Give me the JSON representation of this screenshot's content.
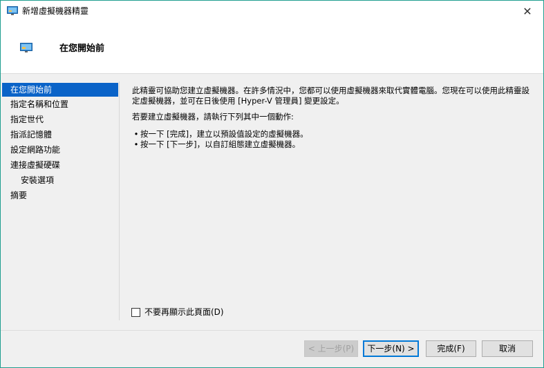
{
  "window": {
    "title": "新增虛擬機器精靈",
    "close_glyph": "✕"
  },
  "header": {
    "title": "在您開始前"
  },
  "nav": {
    "items": [
      {
        "label": "在您開始前",
        "selected": true
      },
      {
        "label": "指定名稱和位置"
      },
      {
        "label": "指定世代"
      },
      {
        "label": "指派記憶體"
      },
      {
        "label": "設定網路功能"
      },
      {
        "label": "連接虛擬硬碟"
      },
      {
        "label": "安裝選項",
        "sub": true
      },
      {
        "label": "摘要"
      }
    ]
  },
  "content": {
    "intro": "此精靈可協助您建立虛擬機器。在許多情況中，您都可以使用虛擬機器來取代實體電腦。您現在可以使用此精靈設定虛擬機器，並可在日後使用 [Hyper-V 管理員] 變更設定。",
    "instruction": "若要建立虛擬機器，請執行下列其中一個動作:",
    "bullet_1": "按一下 [完成]，建立以預設值設定的虛擬機器。",
    "bullet_2": "按一下 [下一步]，以自訂組態建立虛擬機器。",
    "bullet_glyph": "•"
  },
  "checkbox": {
    "label": "不要再顯示此頁面(D)",
    "checked": false
  },
  "buttons": {
    "prev": "< 上一步(P)",
    "next": "下一步(N) >",
    "finish": "完成(F)",
    "cancel": "取消"
  },
  "colors": {
    "accent": "#0a63c8",
    "window_border": "#1f9e8f"
  },
  "icons": {
    "title": "vm-monitor-icon",
    "header": "vm-monitor-icon"
  }
}
